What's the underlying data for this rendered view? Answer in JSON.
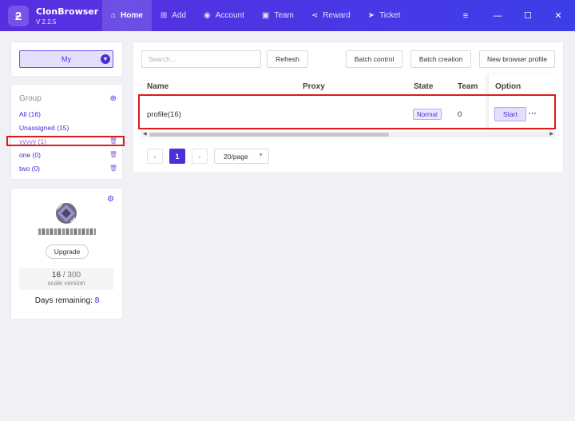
{
  "app": {
    "logo": "ƻ",
    "name": "ClonBrowser",
    "version": "V 2.2.5"
  },
  "nav": [
    {
      "label": "Home",
      "icon": "home-icon",
      "glyph": "⌂"
    },
    {
      "label": "Add",
      "icon": "plus-square-icon",
      "glyph": "⊞"
    },
    {
      "label": "Account",
      "icon": "user-circle-icon",
      "glyph": "◉"
    },
    {
      "label": "Team",
      "icon": "team-icon",
      "glyph": "▣"
    },
    {
      "label": "Reward",
      "icon": "share-icon",
      "glyph": "⋖"
    },
    {
      "label": "Ticket",
      "icon": "paper-plane-icon",
      "glyph": "➤"
    }
  ],
  "window": {
    "menu": "≡",
    "minimize": "—",
    "maximize": "☐",
    "close": "✕"
  },
  "sidebar": {
    "select_value": "My",
    "group_title": "Group",
    "groups": [
      {
        "label": "All  (16)",
        "deletable": false
      },
      {
        "label": "Unassigned  (15)",
        "deletable": false
      },
      {
        "label": "yyyyy  (1)",
        "deletable": true
      },
      {
        "label": "one  (0)",
        "deletable": true
      },
      {
        "label": "two  (0)",
        "deletable": true
      }
    ],
    "upgrade_label": "Upgrade",
    "quota_used": "16",
    "quota_total": " / 300",
    "quota_sub": "scale version",
    "days_label": "Days remaining: ",
    "days_value": "8"
  },
  "toolbar": {
    "search_placeholder": "Search...",
    "refresh": "Refresh",
    "batch_control": "Batch control",
    "batch_creation": "Batch creation",
    "new_profile": "New browser profile"
  },
  "table": {
    "headers": {
      "name": "Name",
      "proxy": "Proxy",
      "state": "State",
      "team": "Team",
      "option": "Option"
    },
    "rows": [
      {
        "name": "profile(16)",
        "proxy": "",
        "state": "Normal",
        "team": "0",
        "start": "Start",
        "more": "···"
      }
    ]
  },
  "pagination": {
    "prev": "‹",
    "page": "1",
    "next": "›",
    "page_size": "20/page"
  },
  "colors": {
    "accent": "#4b2fd9",
    "topbar_start": "#5a2ee0",
    "topbar_end": "#3d3ee8",
    "highlight": "#e0191b"
  }
}
